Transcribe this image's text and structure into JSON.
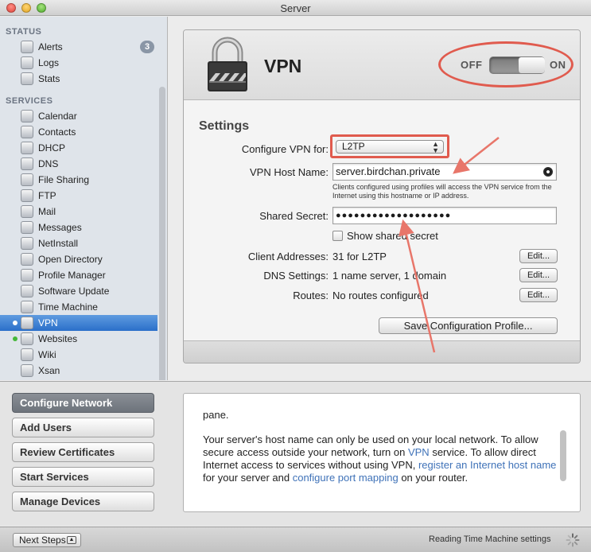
{
  "window": {
    "title": "Server"
  },
  "sidebar": {
    "status_heading": "STATUS",
    "status_items": [
      {
        "label": "Alerts",
        "badge": "3",
        "icon": "alert-icon"
      },
      {
        "label": "Logs",
        "icon": "logs-icon"
      },
      {
        "label": "Stats",
        "icon": "stats-icon"
      }
    ],
    "services_heading": "SERVICES",
    "services_items": [
      {
        "label": "Calendar",
        "icon": "calendar-icon"
      },
      {
        "label": "Contacts",
        "icon": "contacts-icon"
      },
      {
        "label": "DHCP",
        "icon": "dhcp-icon"
      },
      {
        "label": "DNS",
        "icon": "dns-icon"
      },
      {
        "label": "File Sharing",
        "icon": "file-sharing-icon"
      },
      {
        "label": "FTP",
        "icon": "ftp-icon"
      },
      {
        "label": "Mail",
        "icon": "mail-icon"
      },
      {
        "label": "Messages",
        "icon": "messages-icon"
      },
      {
        "label": "NetInstall",
        "icon": "netinstall-icon"
      },
      {
        "label": "Open Directory",
        "icon": "open-directory-icon"
      },
      {
        "label": "Profile Manager",
        "icon": "profile-manager-icon"
      },
      {
        "label": "Software Update",
        "icon": "software-update-icon"
      },
      {
        "label": "Time Machine",
        "icon": "time-machine-icon"
      },
      {
        "label": "VPN",
        "icon": "vpn-icon",
        "selected": true,
        "dot": "white"
      },
      {
        "label": "Websites",
        "icon": "websites-icon",
        "dot": "green"
      },
      {
        "label": "Wiki",
        "icon": "wiki-icon"
      },
      {
        "label": "Xsan",
        "icon": "xsan-icon"
      }
    ]
  },
  "vpn": {
    "title": "VPN",
    "toggle": {
      "off_label": "OFF",
      "on_label": "ON",
      "state": "on"
    },
    "settings_title": "Settings",
    "configure_label": "Configure VPN for:",
    "configure_value": "L2TP",
    "host_label": "VPN Host Name:",
    "host_value": "server.birdchan.private",
    "host_help": "Clients configured using profiles will access the VPN service from the Internet using this hostname or IP address.",
    "secret_label": "Shared Secret:",
    "secret_value": "●●●●●●●●●●●●●●●●●●●",
    "show_secret_label": "Show shared secret",
    "client_label": "Client Addresses:",
    "client_value": "31 for L2TP",
    "dns_label": "DNS Settings:",
    "dns_value": "1 name server, 1 domain",
    "routes_label": "Routes:",
    "routes_value": "No routes configured",
    "edit_label": "Edit...",
    "save_profile_label": "Save Configuration Profile..."
  },
  "next_steps": {
    "buttons": [
      "Configure Network",
      "Add Users",
      "Review Certificates",
      "Start Services",
      "Manage Devices"
    ],
    "active_index": 0,
    "content_line1": "pane.",
    "content_p_a": "Your server's host name can only be used on your local network. To allow secure access outside your network, turn on ",
    "content_link1": "VPN",
    "content_p_b": " service. To allow direct Internet access to services without using VPN, ",
    "content_link2": "register an Internet host name",
    "content_p_c": " for your server and ",
    "content_link3": "configure port mapping",
    "content_p_d": " on your router."
  },
  "bottombar": {
    "next_steps_label": "Next Steps",
    "status_text": "Reading Time Machine settings"
  },
  "colors": {
    "annotation_red": "#e05b4e",
    "selection_blue": "#2a6fc9",
    "link_blue": "#3f72b8"
  }
}
